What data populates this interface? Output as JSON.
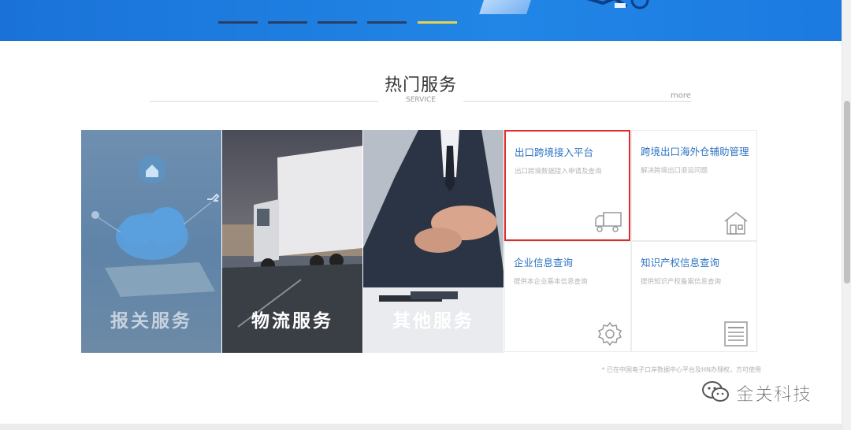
{
  "section": {
    "title": "热门服务",
    "subtitle": "SERVICE",
    "more_label": "more"
  },
  "tiles": [
    {
      "label": "报关服务"
    },
    {
      "label": "物流服务"
    },
    {
      "label": "其他服务"
    }
  ],
  "cards": [
    {
      "title": "出口跨境接入平台",
      "desc": "出口跨境数据接入申请及查询",
      "icon": "truck-icon",
      "highlighted": true
    },
    {
      "title": "跨境出口海外仓辅助管理",
      "desc": "解决跨境出口退运问题",
      "icon": "warehouse-icon",
      "highlighted": false
    },
    {
      "title": "企业信息查询",
      "desc": "提供本企业基本信息查询",
      "icon": "gear-icon",
      "highlighted": false
    },
    {
      "title": "知识产权信息查询",
      "desc": "提供知识产权备案信息查询",
      "icon": "document-icon",
      "highlighted": false
    }
  ],
  "footnote": "* 已在中国电子口岸数据中心平台及HN办理权，方可使用",
  "watermark": {
    "text": "金关科技",
    "icon": "wechat-icon"
  },
  "carousel": {
    "count": 5,
    "active_index": 4
  },
  "colors": {
    "banner": "#1f80e3",
    "card_title": "#2e74c3",
    "highlight_border": "#e02a2a",
    "active_dot": "#e8d24a"
  }
}
